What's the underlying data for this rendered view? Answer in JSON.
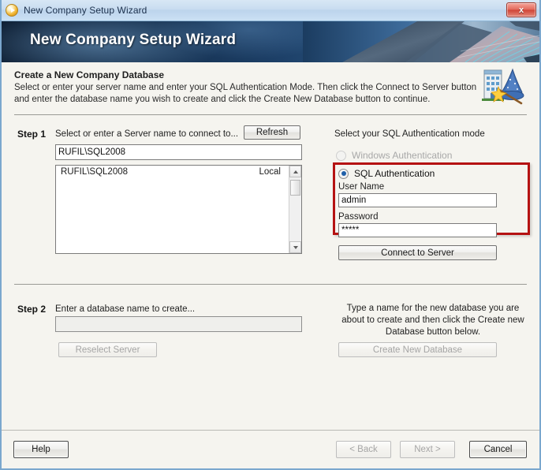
{
  "window": {
    "title": "New Company Setup Wizard",
    "icon": "orange-play-circle-icon",
    "close_label": "x"
  },
  "banner": {
    "heading": "New Company Setup Wizard"
  },
  "description": {
    "title": "Create a New Company Database",
    "body": "Select or enter your server name and enter your SQL Authentication Mode. Then click the Connect to Server button and enter the database name you wish to create and click the Create New Database button to continue.",
    "icon": "building-wizard-hat-icon"
  },
  "step1": {
    "label": "Step 1",
    "instruction": "Select or enter a Server name to connect to...",
    "refresh_label": "Refresh",
    "server_value": "RUFIL\\SQL2008",
    "server_placeholder": "",
    "server_list": [
      {
        "name": "RUFIL\\SQL2008",
        "location": "Local"
      }
    ]
  },
  "auth": {
    "heading": "Select your SQL Authentication mode",
    "windows_option": "Windows Authentication",
    "windows_enabled": false,
    "sql_option": "SQL Authentication",
    "sql_selected": true,
    "user_name_label": "User Name",
    "user_name_value": "admin",
    "password_label": "Password",
    "password_value": "*****",
    "connect_label": "Connect to Server",
    "highlight_color": "#b51212"
  },
  "step2": {
    "label": "Step 2",
    "instruction": "Enter a database name to create...",
    "database_value": "",
    "database_placeholder": "",
    "reselect_label": "Reselect Server",
    "hint": "Type a name for the new database you are about to create and then click the Create new Database button below.",
    "create_label": "Create New Database"
  },
  "footer": {
    "help_label": "Help",
    "back_label": "< Back",
    "next_label": "Next >",
    "cancel_label": "Cancel"
  }
}
